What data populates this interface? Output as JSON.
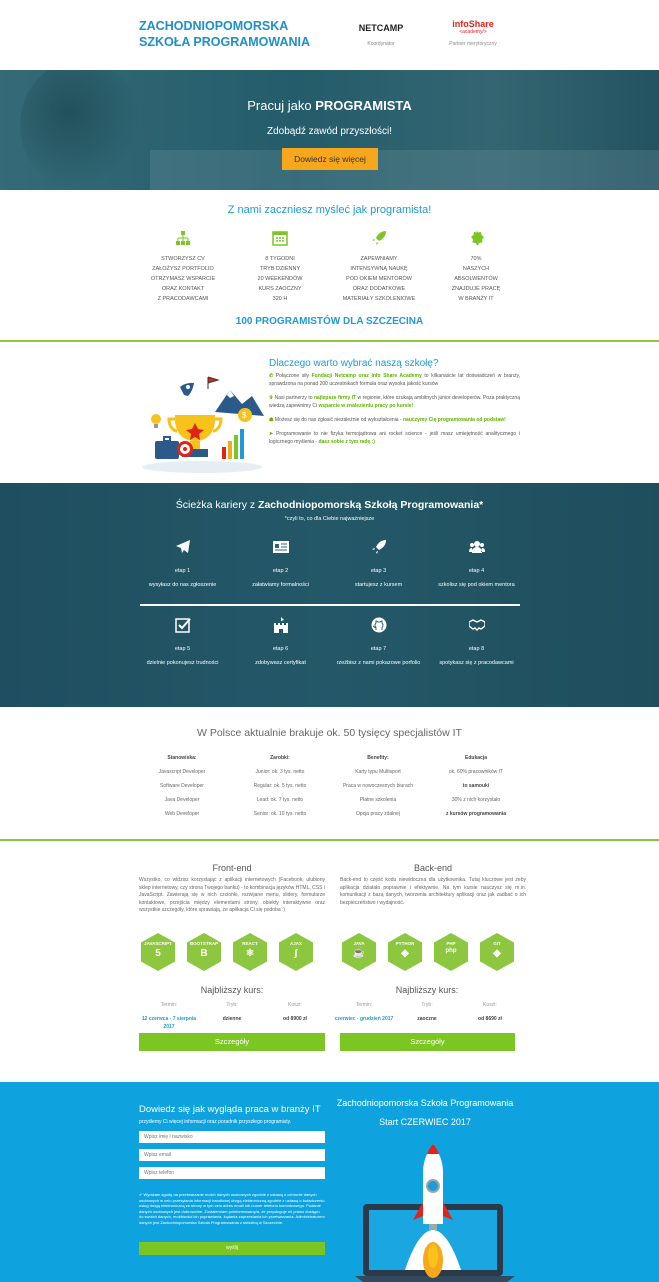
{
  "header": {
    "brand_line1": "ZACHODNIOPOMORSKA",
    "brand_line2": "SZKOŁA PROGRAMOWANIA",
    "partner1_logo": "NETCAMP",
    "partner1_role": "Koordynator",
    "partner2_logo": "infoShare",
    "partner2_logo_sub": "<academy/>",
    "partner2_role": "Partner merytoryczny"
  },
  "hero": {
    "title_prefix": "Pracuj jako ",
    "title_bold": "PROGRAMISTA",
    "subtitle": "Zdobądź zawód przyszłości!",
    "cta": "Dowiedz się więcej"
  },
  "features": {
    "heading": "Z nami zaczniesz myśleć jak programista!",
    "cols": [
      {
        "icon": "org-chart-icon",
        "lines": [
          "STWORZYSZ CV",
          "ZAŁOŻYSZ PORTFOLIO",
          "OTRZYMASZ WSPARCIE",
          "ORAZ KONTAKT",
          "Z PRACODAWCAMI"
        ]
      },
      {
        "icon": "calendar-icon",
        "lines": [
          "8 TYGODNI",
          "TRYB DZIENNY",
          "20 WEEKENDÓW",
          "KURS ZAOCZNY",
          "320 H"
        ]
      },
      {
        "icon": "rocket-icon",
        "lines": [
          "ZAPEWNIAMY",
          "INTENSYWNĄ NAUKĘ",
          "POD OKIEM MENTORÓW",
          "ORAZ DODATKOWE",
          "MATERIAŁY SZKOLENIOWE"
        ]
      },
      {
        "icon": "badge-icon",
        "lines": [
          "70%",
          "NASZYCH",
          "ABSOLWENTÓW",
          "ZNAJDUJE PRACĘ",
          "W BRANŻY IT"
        ]
      }
    ],
    "tagline": "100 PROGRAMISTÓW DLA SZCZECINA"
  },
  "why": {
    "heading": "Dlaczego warto wybrać naszą szkołę?",
    "p1_a": "Połączone siły ",
    "p1_b": "Fundacji Netcamp oraz Info Share Academy",
    "p1_c": " to kilkanaście lat doświadczeń w branży, sprawdzona na ponad 200 uczestnikach formuła oraz wysoka jakość kursów",
    "p2_a": "Nasi partnerzy to ",
    "p2_b": "najlepsze firmy IT",
    "p2_c": " w regionie, które szukają ambitnych junior developerów. Poza praktyczną wiedzą zapewnimy Ci ",
    "p2_d": "wsparcie w znalezieniu pracy po kursie!",
    "p3_a": "Możesz się do nas zgłosić niezależnie od wykształcenia - ",
    "p3_b": "nauczymy Cię programowania od podstaw!",
    "p4_a": "Programowanie to nie fizyka termojądrowa ani rocket science - jeśli masz umiejętność analitycznego i logicznego myślenia - ",
    "p4_b": "dasz sobie z tym radę :)"
  },
  "career": {
    "heading_a": "Ścieżka kariery z ",
    "heading_b": "Zachodniopomorską Szkołą Programowania*",
    "sub": "*czyli to, co dla Ciebie najważniejsze",
    "steps": [
      {
        "icon": "paper-plane-icon",
        "label": "etap 1",
        "desc": "wysyłasz do nas zgłoszenie"
      },
      {
        "icon": "id-card-icon",
        "label": "etap 2",
        "desc": "załatwiamy formalności"
      },
      {
        "icon": "rocket-icon",
        "label": "etap 3",
        "desc": "startujesz z kursem"
      },
      {
        "icon": "group-icon",
        "label": "etap 4",
        "desc": "szkolisz się pod okiem mentora"
      },
      {
        "icon": "checkbox-icon",
        "label": "etap 5",
        "desc": "dzielnie pokonujesz trudności"
      },
      {
        "icon": "castle-icon",
        "label": "etap 6",
        "desc": "zdobywasz certyfikat"
      },
      {
        "icon": "github-icon",
        "label": "etap 7",
        "desc": "rzeźbisz z nami pokazowe porfolio"
      },
      {
        "icon": "handshake-icon",
        "label": "etap 8",
        "desc": "spotykasz się z pracodawcami"
      }
    ]
  },
  "market": {
    "heading": "W Polsce aktualnie brakuje ok. 50 tysięcy specjalistów IT",
    "cols": [
      {
        "head": "Stanowiska:",
        "rows": [
          "Javascript Developer",
          "Software Developer",
          "Java Developer",
          "Web Developer"
        ]
      },
      {
        "head": "Zarobki:",
        "rows": [
          "Junior: ok. 3 tys. netto",
          "Regular: ok. 5 tys. netto",
          "Lead: ok. 7 tys. netto",
          "Senior: ok. 10 tys. netto"
        ]
      },
      {
        "head": "Benefity:",
        "rows": [
          "Karty typu Multisport",
          "Praca w nowoczesnych biurach",
          "Płatne szkolenia",
          "Opcja pracy zdalnej"
        ]
      },
      {
        "head": "Edukacja",
        "rows": [
          "ok. 60% pracowników IT",
          "to samouki",
          "30% z nich korzystało",
          "z kursów programowania"
        ]
      }
    ]
  },
  "frontend": {
    "title": "Front-end",
    "desc": "Wszystko, co widzisz korzystając z aplikacji internetowych (Facebook, ulubiony sklep internetowy, czy strona Twojego banku) - to kombinacja języków HTML, CSS i JavaScript. Zawierają się w nich czcionki, rozwijane menu, slidery, formularze kontaktowe, przejścia między elementami strony, obiekty interaktywne oraz wszystkie szczegóły, które sprawiają, że aplikacja Ci się podoba :)",
    "badges": [
      {
        "name": "JAVASCRIPT",
        "glyph": "5"
      },
      {
        "name": "BOOTSTRAP",
        "glyph": "B"
      },
      {
        "name": "REACT",
        "glyph": "⚛"
      },
      {
        "name": "AJAX",
        "glyph": "∫"
      }
    ],
    "next": "Najbliższy kurs:",
    "th": [
      "Termin:",
      "Tryb:",
      "Koszt:"
    ],
    "term": "12 czerwca - 7 sierpnia 2017",
    "mode": "dzienne",
    "cost": "od 8900 zł",
    "btn": "Szczegóły"
  },
  "backend": {
    "title": "Back-end",
    "desc": "Back-end to część kodu niewidoczna dla użytkownika. Tutaj kluczowe jest żeby aplikacja działała poprawnie i efektywnie. Na tym kursie nauczysz się m.in. komunikacji z bazą danych, tworzenia architektury aplikacji oraz jak zadbać o ich bezpieczeństwo i wydajność.",
    "badges": [
      {
        "name": "JAVA",
        "glyph": "☕"
      },
      {
        "name": "PYTHON",
        "glyph": "◈"
      },
      {
        "name": "PHP",
        "glyph": "php"
      },
      {
        "name": "GIT",
        "glyph": "◆"
      }
    ],
    "next": "Najbliższy kurs:",
    "th": [
      "Termin:",
      "Tryb:",
      "Koszt:"
    ],
    "term": "czerwiec - grudzień 2017",
    "mode": "zaoczne",
    "cost": "od 8690 zł",
    "btn": "Szczegóły"
  },
  "contact": {
    "heading": "Dowiedz się jak wygląda praca w branży IT",
    "sub": "przyślemy Ci więcej informacji oraz poradnik przyszłego programisty.",
    "name_ph": "Wpisz imię i nazwisko",
    "email_ph": "Wpisz email",
    "phone_ph": "Wpisz telefon",
    "consent": "✔ Wyrażam zgodę na przetwarzanie moich danych osobowych zgodnie z ustawą o ochronie danych osobowych w celu przesyłania informacji handlowej drogą elektroniczną zgodnie z ustawą o świadczeniu usług drogą elektroniczną ze strony w tym celu adres email lub numer telefonu komórkowego. Podanie danych osobowych jest dobrowolne. Zostałem/am poinformowany/a, że przysługuje mi prawo dostępu do swoich danych, możliwości ich poprawiania, żądania zaprzestania ich przetwarzania. Administratorem danych jest Zachodniopomorska Szkoła Programowania z siedzibą w Szczecinie.",
    "submit": "wyślij",
    "right_title": "Zachodniopomorska Szkoła Programowania",
    "right_sub": "Start CZERWIEC 2017"
  },
  "colors": {
    "blue": "#1f9ad6",
    "green": "#8dc63f",
    "orange": "#f7a71b",
    "contact_bg": "#0ea3df"
  }
}
